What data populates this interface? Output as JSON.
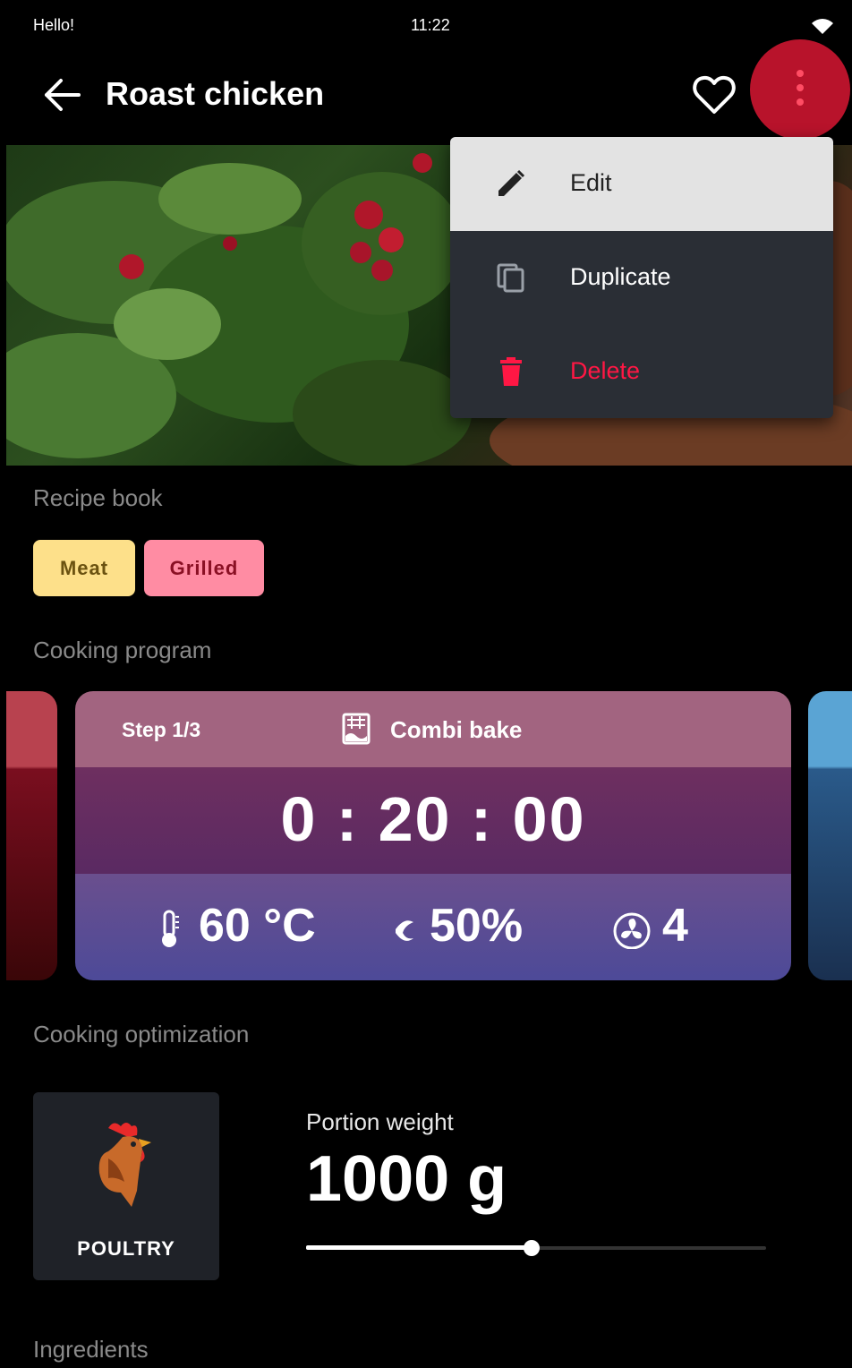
{
  "status": {
    "greeting": "Hello!",
    "time": "11:22"
  },
  "header": {
    "title": "Roast chicken"
  },
  "menu": {
    "items": [
      {
        "label": "Edit",
        "icon": "pencil-icon"
      },
      {
        "label": "Duplicate",
        "icon": "copy-icon"
      },
      {
        "label": "Delete",
        "icon": "trash-icon",
        "color": "#ff1744"
      }
    ]
  },
  "recipe_book": {
    "label": "Recipe book",
    "chips": [
      {
        "label": "Meat",
        "color": "#fde08a"
      },
      {
        "label": "Grilled",
        "color": "#ff8ca3"
      }
    ]
  },
  "cooking_program": {
    "label": "Cooking program",
    "step": "Step 1/3",
    "mode": "Combi bake",
    "time": "0 : 20 : 00",
    "temperature": "60 °C",
    "humidity": "50%",
    "fan": "4"
  },
  "optimization": {
    "label": "Cooking optimization",
    "category": "POULTRY",
    "portion_label": "Portion weight",
    "portion_value": "1000 g",
    "slider_fraction": 0.49
  },
  "ingredients": {
    "label": "Ingredients"
  }
}
